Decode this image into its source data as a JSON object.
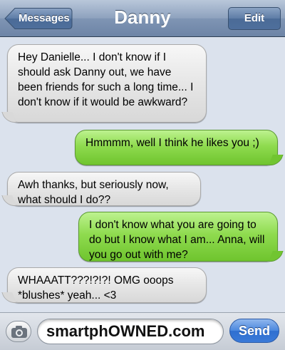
{
  "navbar": {
    "title": "Danny",
    "back_label": "Messages",
    "edit_label": "Edit"
  },
  "messages": [
    {
      "direction": "incoming",
      "text": "Hey Danielle... I don't know if I should ask Danny out, we have been friends for such a long time... I don't know if it would be awkward?"
    },
    {
      "direction": "outgoing",
      "text": "Hmmmm, well I think he likes you ;)"
    },
    {
      "direction": "incoming",
      "text": "Awh thanks, but seriously now, what should I do??"
    },
    {
      "direction": "outgoing",
      "text": "I don't know what you are going to do but I know what I am... Anna, will you go out with me?"
    },
    {
      "direction": "incoming",
      "text": "WHAAATT???!?!?! OMG ooops *blushes* yeah... <3"
    }
  ],
  "composer": {
    "input_value": "smartphOWNED.com",
    "send_label": "Send",
    "camera_icon": "camera-icon"
  },
  "colors": {
    "incoming_bubble": "#e6e6e6",
    "outgoing_bubble": "#8fdb4f",
    "send_button": "#3a7ad8",
    "navbar": "#7f95b4"
  }
}
